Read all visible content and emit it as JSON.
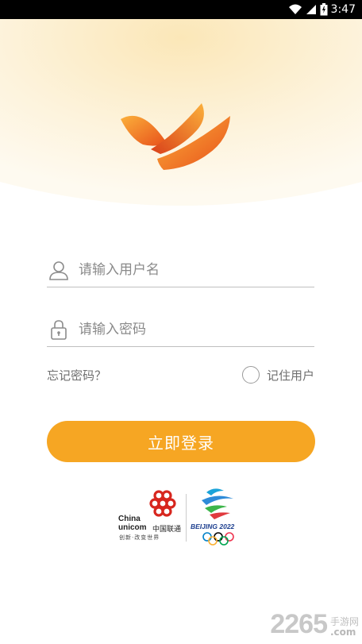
{
  "status_bar": {
    "time": "3:47",
    "icons": [
      "wifi-icon",
      "signal-icon",
      "battery-icon"
    ]
  },
  "login": {
    "username_placeholder": "请输入用户名",
    "password_placeholder": "请输入密码",
    "username_value": "",
    "password_value": "",
    "forgot_password": "忘记密码？",
    "remember_user": "记住用户",
    "remember_checked": false,
    "submit": "立即登录"
  },
  "sponsors": {
    "unicom_en_1": "China",
    "unicom_en_2": "unicom",
    "unicom_cn": "中国联通",
    "unicom_slogan": "创新·改变世界",
    "beijing_text": "BEIJING 2022"
  },
  "watermark": {
    "number": "2265",
    "suffix_cn": "手游网",
    "suffix_en": ".com"
  },
  "colors": {
    "accent": "#f6a623",
    "header_glow": "#fdf3dc",
    "logo_orange": "#f07a1e"
  }
}
